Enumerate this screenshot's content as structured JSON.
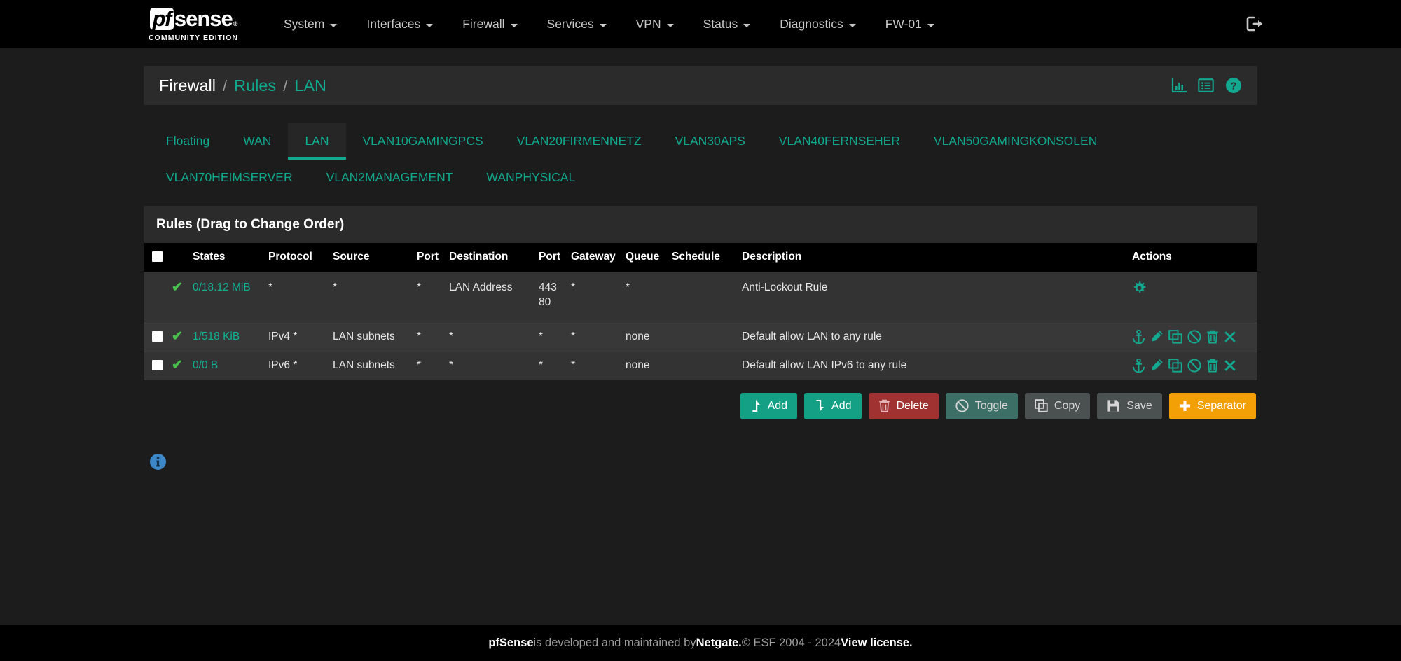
{
  "navbar": {
    "brand": {
      "pf": "pf",
      "sense": "sense",
      "reg": "®",
      "subtitle": "COMMUNITY EDITION"
    },
    "items": [
      {
        "label": "System",
        "caret": true
      },
      {
        "label": "Interfaces",
        "caret": true
      },
      {
        "label": "Firewall",
        "caret": true
      },
      {
        "label": "Services",
        "caret": true
      },
      {
        "label": "VPN",
        "caret": true
      },
      {
        "label": "Status",
        "caret": true
      },
      {
        "label": "Diagnostics",
        "caret": true
      },
      {
        "label": "FW-01",
        "caret": true
      }
    ],
    "logout_icon": "logout-icon"
  },
  "header": {
    "crumb1": "Firewall",
    "sep": "/",
    "crumb2": "Rules",
    "crumb3": "LAN",
    "icons": [
      "chart-bar-icon",
      "log-list-icon",
      "help-circle-icon"
    ]
  },
  "tabs": [
    {
      "label": "Floating",
      "active": false
    },
    {
      "label": "WAN",
      "active": false
    },
    {
      "label": "LAN",
      "active": true
    },
    {
      "label": "VLAN10GAMINGPCS",
      "active": false
    },
    {
      "label": "VLAN20FIRMENNETZ",
      "active": false
    },
    {
      "label": "VLAN30APS",
      "active": false
    },
    {
      "label": "VLAN40FERNSEHER",
      "active": false
    },
    {
      "label": "VLAN50GAMINGKONSOLEN",
      "active": false
    },
    {
      "label": "VLAN70HEIMSERVER",
      "active": false
    },
    {
      "label": "VLAN2MANAGEMENT",
      "active": false
    },
    {
      "label": "WANPHYSICAL",
      "active": false
    }
  ],
  "panel": {
    "title": "Rules (Drag to Change Order)",
    "columns": [
      "",
      "",
      "States",
      "Protocol",
      "Source",
      "Port",
      "Destination",
      "Port",
      "Gateway",
      "Queue",
      "Schedule",
      "Description",
      "Actions"
    ],
    "rows": [
      {
        "checkbox": false,
        "status": "✔",
        "states": "0/18.12 MiB",
        "protocol": "*",
        "source": "*",
        "source_port": "*",
        "destination": "LAN Address",
        "dest_port_1": "443",
        "dest_port_2": "80",
        "gateway": "*",
        "queue": "*",
        "schedule": "",
        "description": "Anti-Lockout Rule",
        "actions": [
          "gear-icon"
        ]
      },
      {
        "checkbox": true,
        "status": "✔",
        "states": "1/518 KiB",
        "protocol": "IPv4 *",
        "source": "LAN subnets",
        "source_port": "*",
        "destination": "*",
        "dest_port_1": "*",
        "dest_port_2": "",
        "gateway": "*",
        "queue": "none",
        "schedule": "",
        "description": "Default allow LAN to any rule",
        "actions": [
          "anchor-icon",
          "pencil-icon",
          "copy-icon",
          "ban-icon",
          "trash-icon",
          "close-icon"
        ]
      },
      {
        "checkbox": true,
        "status": "✔",
        "states": "0/0 B",
        "protocol": "IPv6 *",
        "source": "LAN subnets",
        "source_port": "*",
        "destination": "*",
        "dest_port_1": "*",
        "dest_port_2": "",
        "gateway": "*",
        "queue": "none",
        "schedule": "",
        "description": "Default allow LAN IPv6 to any rule",
        "actions": [
          "anchor-icon",
          "pencil-icon",
          "copy-icon",
          "ban-icon",
          "trash-icon",
          "close-icon"
        ]
      }
    ]
  },
  "buttons": [
    {
      "label": "Add",
      "icon": "arrow-up-icon",
      "style": "success"
    },
    {
      "label": "Add",
      "icon": "arrow-down-icon",
      "style": "success"
    },
    {
      "label": "Delete",
      "icon": "trash-icon",
      "style": "danger"
    },
    {
      "label": "Toggle",
      "icon": "ban-icon",
      "style": "muted"
    },
    {
      "label": "Copy",
      "icon": "copy-icon",
      "style": "muted2"
    },
    {
      "label": "Save",
      "icon": "save-icon",
      "style": "muted2"
    },
    {
      "label": "Separator",
      "icon": "plus-icon",
      "style": "warning"
    }
  ],
  "legend": {
    "icon": "info-circle-icon"
  },
  "footer": {
    "brand": "pfSense",
    "text1": " is developed and maintained by ",
    "company": "Netgate.",
    "text2": " © ESF 2004 - 2024 ",
    "license": "View license."
  },
  "colors": {
    "accent_teal": "#10a98d",
    "status_green": "#49c24c",
    "danger_red": "#a03232",
    "warning_orange": "#f3a007",
    "info_blue": "#3c87c8"
  }
}
